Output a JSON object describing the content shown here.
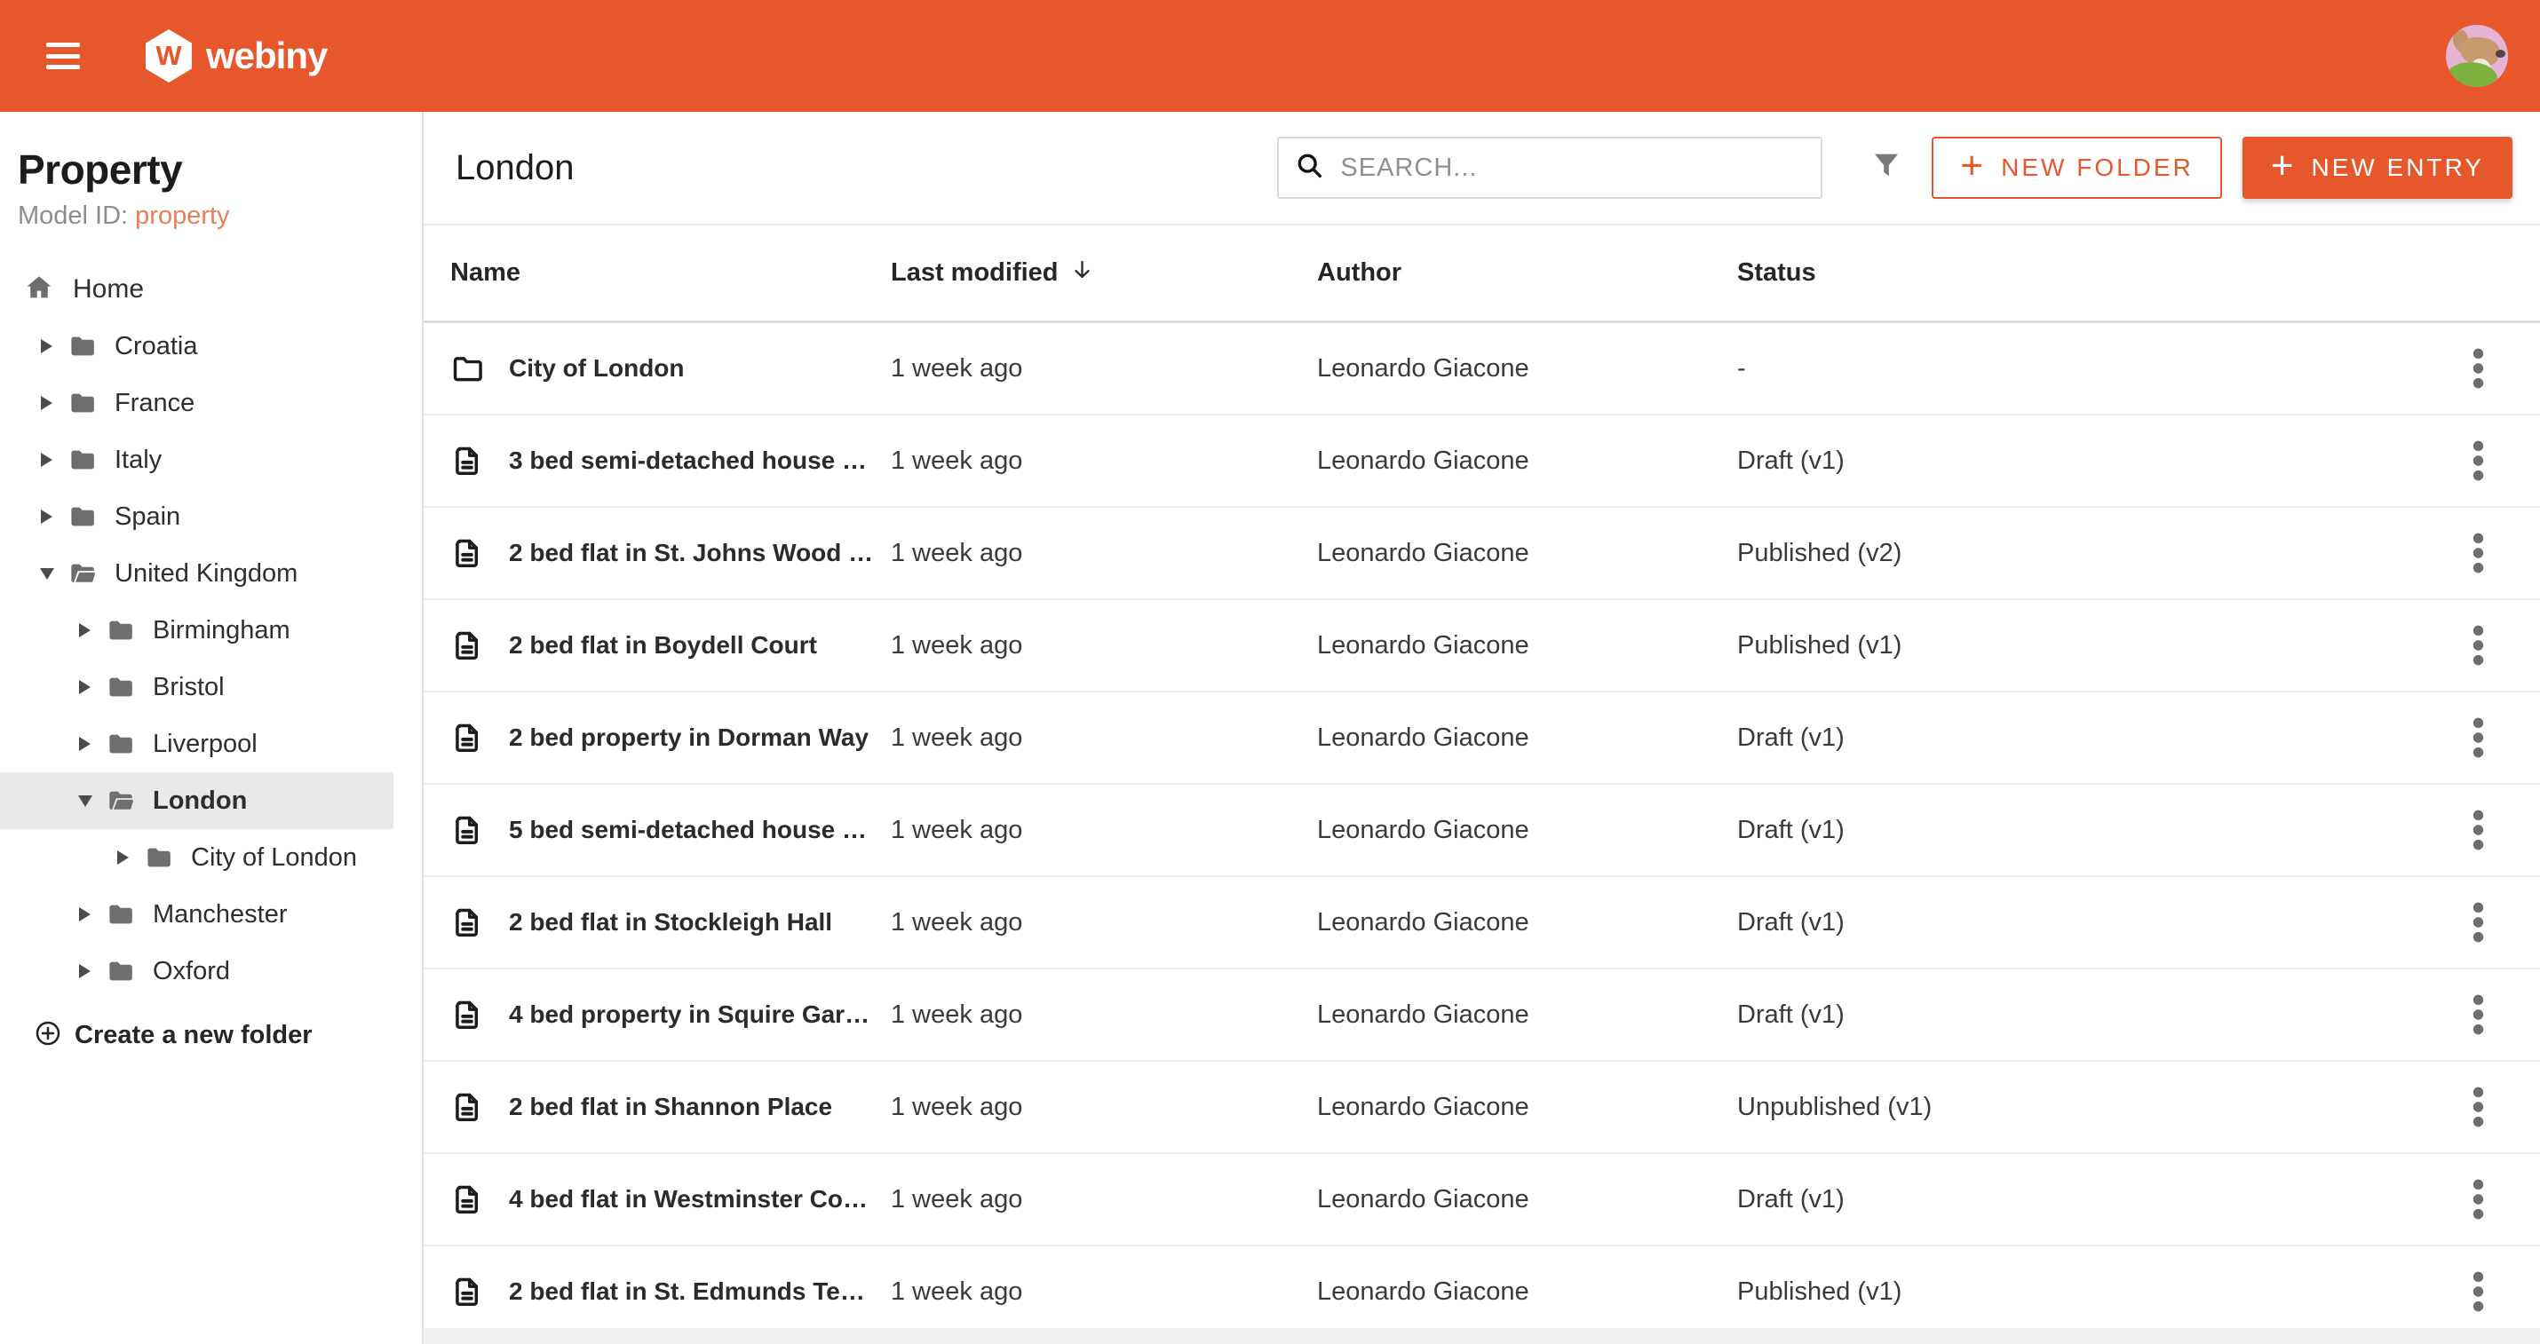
{
  "colors": {
    "brand": "#E6582C",
    "model_id_accent": "#E5815B",
    "selected_tree_bg": "#E9E9E9",
    "topbar": "#E6582C"
  },
  "topbar": {
    "brand_initial": "W",
    "brand_name": "webiny"
  },
  "sidebar": {
    "title": "Property",
    "model_id_label": "Model ID:",
    "model_id_value": "property",
    "home_label": "Home",
    "create_folder_label": "Create a new folder",
    "tree": [
      {
        "label": "Croatia",
        "level": 1,
        "expanded": false,
        "selected": false
      },
      {
        "label": "France",
        "level": 1,
        "expanded": false,
        "selected": false
      },
      {
        "label": "Italy",
        "level": 1,
        "expanded": false,
        "selected": false
      },
      {
        "label": "Spain",
        "level": 1,
        "expanded": false,
        "selected": false
      },
      {
        "label": "United Kingdom",
        "level": 1,
        "expanded": true,
        "selected": false
      },
      {
        "label": "Birmingham",
        "level": 2,
        "expanded": false,
        "selected": false
      },
      {
        "label": "Bristol",
        "level": 2,
        "expanded": false,
        "selected": false
      },
      {
        "label": "Liverpool",
        "level": 2,
        "expanded": false,
        "selected": false
      },
      {
        "label": "London",
        "level": 2,
        "expanded": true,
        "selected": true
      },
      {
        "label": "City of London",
        "level": 3,
        "expanded": false,
        "selected": false
      },
      {
        "label": "Manchester",
        "level": 2,
        "expanded": false,
        "selected": false
      },
      {
        "label": "Oxford",
        "level": 2,
        "expanded": false,
        "selected": false
      }
    ]
  },
  "main": {
    "title": "London",
    "search": {
      "placeholder": "SEARCH..."
    },
    "actions": {
      "plus": "+",
      "new_folder_label": "NEW FOLDER",
      "new_entry_label": "NEW ENTRY"
    },
    "table": {
      "columns": {
        "name": "Name",
        "modified": "Last modified",
        "author": "Author",
        "status": "Status"
      },
      "sorted_by": "Last modified",
      "sort_direction": "descending",
      "rows": [
        {
          "type": "folder",
          "name": "City of London",
          "modified": "1 week ago",
          "author": "Leonardo Giacone",
          "status": "-"
        },
        {
          "type": "entry",
          "name": "3 bed semi-detached house …",
          "modified": "1 week ago",
          "author": "Leonardo Giacone",
          "status": "Draft (v1)"
        },
        {
          "type": "entry",
          "name": "2 bed flat in St. Johns Wood …",
          "modified": "1 week ago",
          "author": "Leonardo Giacone",
          "status": "Published (v2)"
        },
        {
          "type": "entry",
          "name": "2 bed flat in Boydell Court",
          "modified": "1 week ago",
          "author": "Leonardo Giacone",
          "status": "Published (v1)"
        },
        {
          "type": "entry",
          "name": "2 bed property in Dorman Way",
          "modified": "1 week ago",
          "author": "Leonardo Giacone",
          "status": "Draft (v1)"
        },
        {
          "type": "entry",
          "name": "5 bed semi-detached house …",
          "modified": "1 week ago",
          "author": "Leonardo Giacone",
          "status": "Draft (v1)"
        },
        {
          "type": "entry",
          "name": "2 bed flat in Stockleigh Hall",
          "modified": "1 week ago",
          "author": "Leonardo Giacone",
          "status": "Draft (v1)"
        },
        {
          "type": "entry",
          "name": "4 bed property in Squire Gar…",
          "modified": "1 week ago",
          "author": "Leonardo Giacone",
          "status": "Draft (v1)"
        },
        {
          "type": "entry",
          "name": "2 bed flat in Shannon Place",
          "modified": "1 week ago",
          "author": "Leonardo Giacone",
          "status": "Unpublished (v1)"
        },
        {
          "type": "entry",
          "name": "4 bed flat in Westminster Co…",
          "modified": "1 week ago",
          "author": "Leonardo Giacone",
          "status": "Draft (v1)"
        },
        {
          "type": "entry",
          "name": "2 bed flat in St. Edmunds Te…",
          "modified": "1 week ago",
          "author": "Leonardo Giacone",
          "status": "Published (v1)"
        }
      ]
    }
  }
}
